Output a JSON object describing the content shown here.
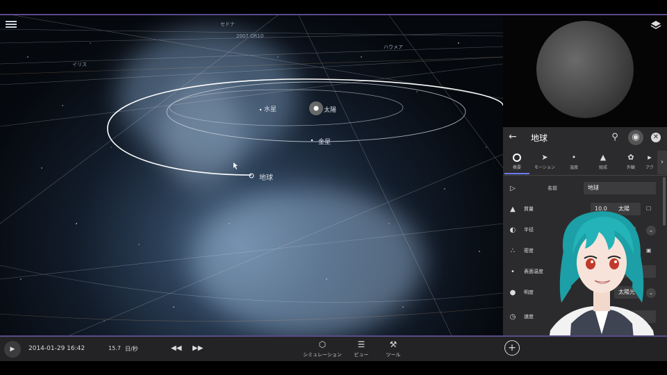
{
  "viewport": {
    "labels": {
      "sun": "太陽",
      "venus": "金星",
      "mercury": "水星",
      "earth": "地球",
      "object1": "2007 OR10",
      "object2": "イリス",
      "object3": "セドナ",
      "object4": "ハウメア"
    }
  },
  "panel": {
    "title": "地球",
    "tabs": [
      {
        "label": "概要",
        "icon": "circle-icon"
      },
      {
        "label": "モーション",
        "icon": "motion-icon"
      },
      {
        "label": "温度",
        "icon": "thermometer-icon"
      },
      {
        "label": "組成",
        "icon": "composition-icon"
      },
      {
        "label": "外観",
        "icon": "palette-icon"
      },
      {
        "label": "アク",
        "icon": "action-icon"
      }
    ],
    "properties": [
      {
        "label": "名前",
        "value": "地球"
      },
      {
        "label": "質量",
        "value": "10.0",
        "unit": "太陽"
      },
      {
        "label": "半径",
        "value": ""
      },
      {
        "label": "密度",
        "value": ""
      },
      {
        "label": "表面温度",
        "value": ""
      },
      {
        "label": "明度",
        "value": "",
        "unit": "太陽光"
      },
      {
        "label": "速度",
        "value": ""
      }
    ]
  },
  "bottom": {
    "date": "2014-01-29 16:42",
    "speed_value": "15.7",
    "speed_unit": "日/秒",
    "tools": [
      {
        "label": "シミュレーション",
        "icon": "cube-icon"
      },
      {
        "label": "ビュー",
        "icon": "layers-icon"
      },
      {
        "label": "ツール",
        "icon": "wrench-icon"
      }
    ]
  },
  "colors": {
    "accent": "#6d7cff",
    "frame": "#5b4a8a",
    "panel_bg": "#2b2b2d"
  }
}
